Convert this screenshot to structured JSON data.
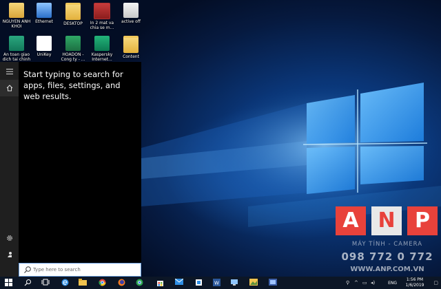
{
  "desktop": {
    "icons": [
      {
        "label": "NGUYEN ANH KHOI",
        "icon": "user-folder-icon"
      },
      {
        "label": "Ethernet",
        "icon": "network-icon"
      },
      {
        "label": "DESKTOP",
        "icon": "folder-icon"
      },
      {
        "label": "In 2 mat va chia se m...",
        "icon": "video-icon"
      },
      {
        "label": "active off",
        "icon": "shortcut-icon"
      },
      {
        "label": "An toan giao dich tai chinh",
        "icon": "security-app-icon"
      },
      {
        "label": "UniKey",
        "icon": "unikey-icon"
      },
      {
        "label": "HOADON - Cong ty - ...",
        "icon": "excel-file-icon"
      },
      {
        "label": "Kaspersky Internet...",
        "icon": "kaspersky-icon"
      },
      {
        "label": "Content",
        "icon": "folder-icon"
      }
    ]
  },
  "start": {
    "hint": "Start typing to search for apps, files, settings, and web results.",
    "rail": {
      "menu_icon": "hamburger-menu-icon",
      "home_icon": "home-icon",
      "settings_icon": "settings-gear-icon",
      "user_icon": "user-feedback-icon"
    }
  },
  "search": {
    "placeholder": "Type here to search"
  },
  "watermark": {
    "letters": [
      "A",
      "N",
      "P"
    ],
    "subtitle": "MÁY TÍNH - CAMERA",
    "phone": "098 772 0 772",
    "website": "WWW.ANP.COM.VN"
  },
  "taskbar": {
    "apps": [
      "search-icon",
      "task-view-icon",
      "edge-icon",
      "file-explorer-icon",
      "chrome-icon",
      "firefox-icon",
      "chrome-alt-icon",
      "store-icon",
      "mail-icon",
      "app-icon",
      "word-icon",
      "network-app-icon",
      "photos-icon",
      "system-icon",
      "settings-icon"
    ],
    "language": "ENG",
    "time": "1:56 PM",
    "date": "1/6/2019"
  },
  "colors": {
    "start_panel": "#000000",
    "rail": "#1f1f1f",
    "taskbar": "#0c1626",
    "accent": "#e8423b"
  }
}
